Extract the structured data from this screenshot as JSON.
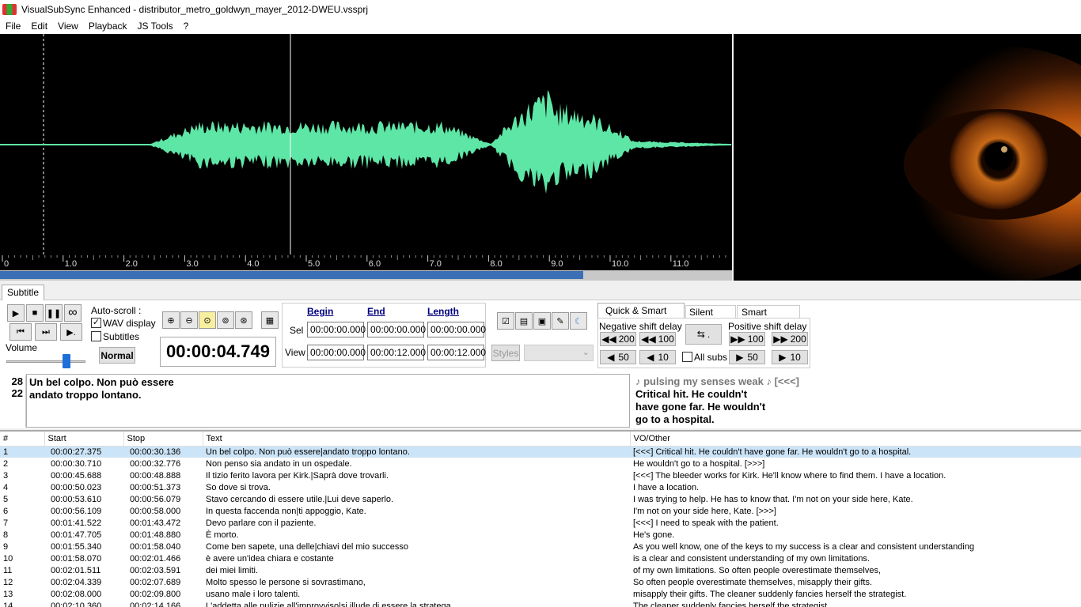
{
  "window": {
    "title": "VisualSubSync Enhanced - distributor_metro_goldwyn_mayer_2012-DWEU.vssprj"
  },
  "menu": [
    "File",
    "Edit",
    "View",
    "Playback",
    "JS Tools",
    "?"
  ],
  "waveform": {
    "ticks": [
      "0",
      "1.0",
      "2.0",
      "3.0",
      "4.0",
      "5.0",
      "6.0",
      "7.0",
      "8.0",
      "9.0",
      "10.0",
      "11.0"
    ],
    "colors": {
      "wave": "#5ee6a6",
      "background": "#000000",
      "cursor": "#ffffff",
      "scroll": "#3a6fb5"
    },
    "scroll_progress": 0.797
  },
  "tabs": {
    "subtitle": "Subtitle"
  },
  "controls": {
    "autoscroll_label": "Auto-scroll :",
    "wav_display": "WAV display",
    "subtitles": "Subtitles",
    "volume_label": "Volume",
    "volume_level": 0.85,
    "normal_button": "Normal",
    "timer": "00:00:04.749",
    "begin": "Begin",
    "end": "End",
    "length": "Length",
    "sel_label": "Sel",
    "view_label": "View",
    "sel_begin": "00:00:00.000",
    "sel_end": "00:00:00.000",
    "sel_length": "00:00:00.000",
    "view_begin": "00:00:00.000",
    "view_end": "00:00:12.000",
    "view_length": "00:00:12.000",
    "styles_button": "Styles",
    "tabs": [
      "Quick & Smart Delay",
      "Silent Zone",
      "Smart Desynch"
    ],
    "negative_label": "Negative shift delay",
    "positive_label": "Positive shift delay",
    "neg200": "200",
    "neg100": "100",
    "neg50": "50",
    "neg10": "10",
    "pos100": "100",
    "pos200": "200",
    "pos50": "50",
    "pos10": "10",
    "all_subs": "All subs",
    "shift_button": "."
  },
  "editor": {
    "line1_count": "28",
    "line2_count": "22",
    "line1": "Un bel colpo. Non può essere",
    "line2": "andato troppo lontano.",
    "vo_line0": "♪ pulsing my senses weak ♪ [<<<]",
    "vo_line1": "Critical hit. He couldn't",
    "vo_line2": "have gone far. He wouldn't",
    "vo_line3": "go to a hospital."
  },
  "grid": {
    "headers": [
      "#",
      "Start",
      "Stop",
      "Text",
      "VO/Other"
    ],
    "rows": [
      [
        "1",
        "00:00:27.375",
        "00:00:30.136",
        "Un bel colpo. Non può essere|andato troppo lontano.",
        "[<<<] Critical hit. He couldn't have gone far. He wouldn't go to a hospital."
      ],
      [
        "2",
        "00:00:30.710",
        "00:00:32.776",
        "Non penso sia andato in un ospedale.",
        "He wouldn't go to a hospital. [>>>]"
      ],
      [
        "3",
        "00:00:45.688",
        "00:00:48.888",
        "Il tizio ferito lavora per Kirk.|Saprà dove trovarli.",
        "[<<<] The bleeder works for Kirk. He'll know where to find them. I have a location."
      ],
      [
        "4",
        "00:00:50.023",
        "00:00:51.373",
        "So dove si trova.",
        "I have a location."
      ],
      [
        "5",
        "00:00:53.610",
        "00:00:56.079",
        "Stavo cercando di essere utile.|Lui deve saperlo.",
        "I was trying to help. He has to know that. I'm not on your side here, Kate."
      ],
      [
        "6",
        "00:00:56.109",
        "00:00:58.000",
        "In questa faccenda non|ti appoggio, Kate.",
        "I'm not on your side here, Kate. [>>>]"
      ],
      [
        "7",
        "00:01:41.522",
        "00:01:43.472",
        "Devo parlare con il paziente.",
        "[<<<] I need to speak with the patient."
      ],
      [
        "8",
        "00:01:47.705",
        "00:01:48.880",
        "È morto.",
        "He's gone."
      ],
      [
        "9",
        "00:01:55.340",
        "00:01:58.040",
        "Come ben sapete, una delle|chiavi del mio successo",
        "As you well know, one of the keys to my success is a clear and consistent understanding"
      ],
      [
        "10",
        "00:01:58.070",
        "00:02:01.466",
        "è avere un'idea chiara e costante",
        "is a clear and consistent understanding of my own limitations."
      ],
      [
        "11",
        "00:02:01.511",
        "00:02:03.591",
        "dei miei limiti.",
        "of my own limitations. So often people overestimate themselves,"
      ],
      [
        "12",
        "00:02:04.339",
        "00:02:07.689",
        "Molto spesso le persone si sovrastimano,",
        "So often people overestimate themselves, misapply their gifts."
      ],
      [
        "13",
        "00:02:08.000",
        "00:02:09.800",
        "usano male i loro talenti.",
        "misapply their gifts. The cleaner suddenly fancies herself the strategist."
      ],
      [
        "14",
        "00:02:10.360",
        "00:02:14.166",
        "L'addetta alle pulizie all'improvviso|si illude di essere la stratega",
        "The cleaner suddenly fancies herself the strategist."
      ]
    ]
  }
}
